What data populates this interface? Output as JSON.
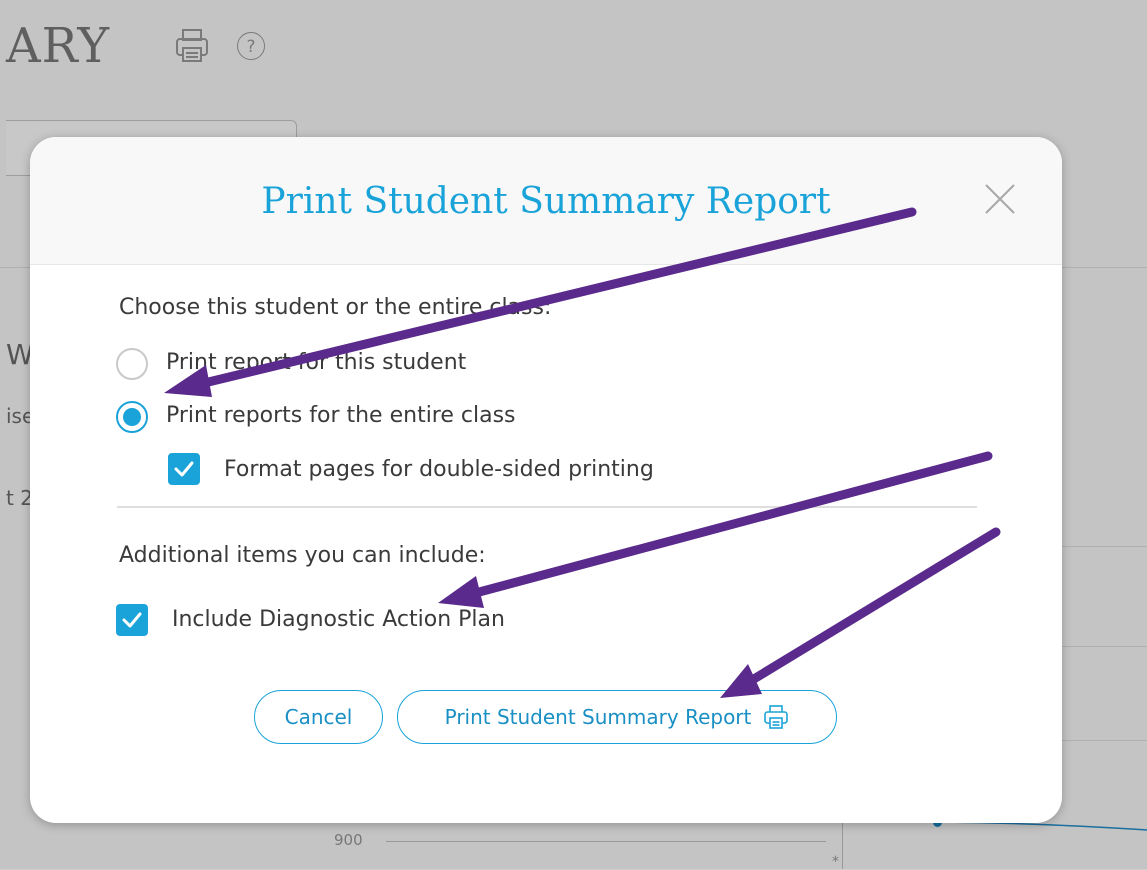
{
  "background": {
    "title_fragment": "ARY",
    "side_fragments": [
      "W",
      "ise",
      "t 2"
    ],
    "axis_tick": "900",
    "axis_marker": "*"
  },
  "modal": {
    "title": "Print Student Summary Report",
    "section1_label": "Choose this student or the entire class:",
    "options": [
      {
        "label": "Print report for this student",
        "checked": false
      },
      {
        "label": "Print reports for the entire class",
        "checked": true
      }
    ],
    "double_sided_label": "Format pages for double-sided printing",
    "double_sided_checked": true,
    "section2_label": "Additional items you can include:",
    "include_plan_label": "Include Diagnostic Action Plan",
    "include_plan_checked": true,
    "cancel_label": "Cancel",
    "print_label": "Print Student Summary Report"
  },
  "colors": {
    "accent": "#1aa3d9",
    "annotation_arrow": "#5a2a8c",
    "dim_background": "#c4c4c4"
  }
}
